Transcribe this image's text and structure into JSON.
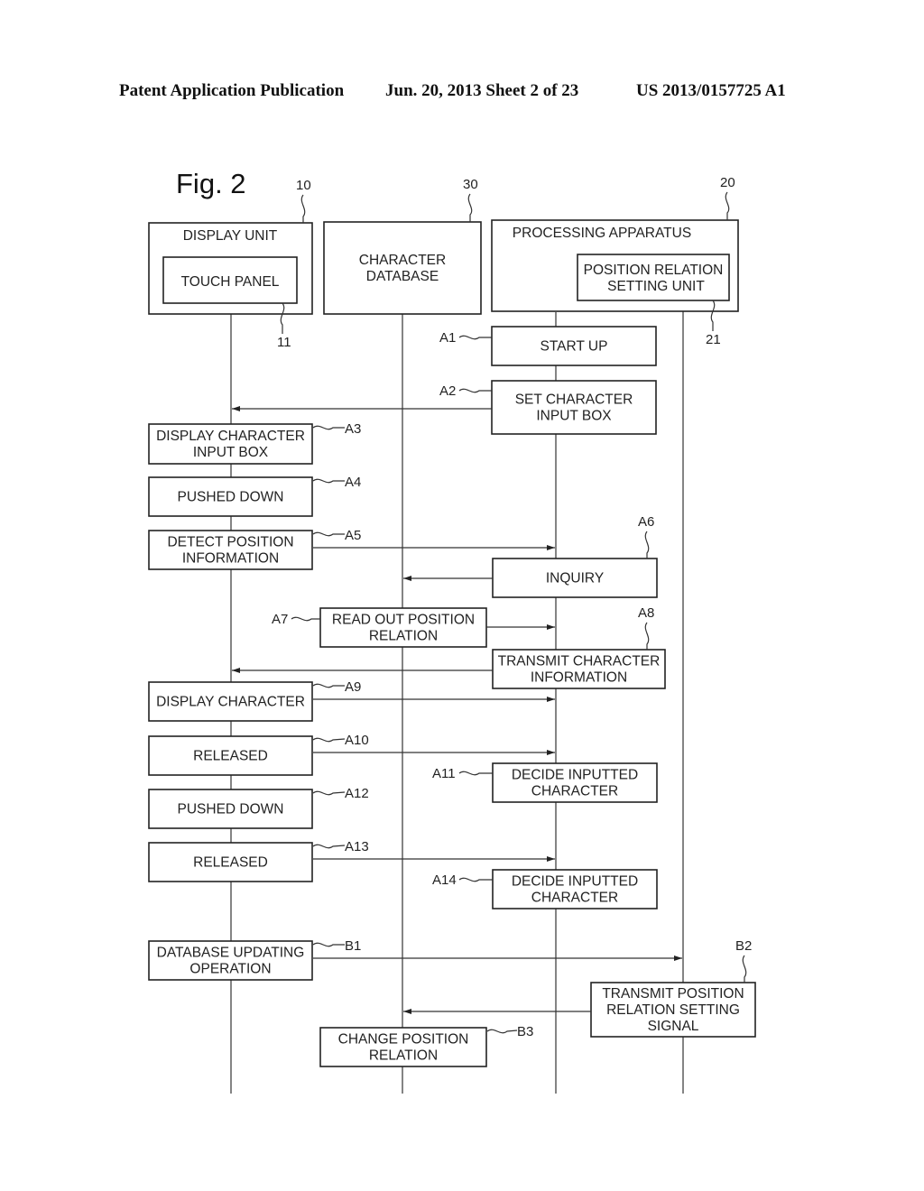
{
  "header": {
    "left": "Patent Application Publication",
    "middle": "Jun. 20, 2013  Sheet 2 of 23",
    "right": "US 2013/0157725 A1"
  },
  "figure": {
    "title": "Fig. 2",
    "lifelines": {
      "display_unit": {
        "ref": "10",
        "label": "DISPLAY UNIT",
        "sub": {
          "ref": "11",
          "label": "TOUCH PANEL"
        }
      },
      "character_database": {
        "ref": "30",
        "lines": [
          "CHARACTER",
          "DATABASE"
        ]
      },
      "processing_apparatus": {
        "ref": "20",
        "label": "PROCESSING APPARATUS",
        "sub": {
          "ref": "21",
          "lines": [
            "POSITION RELATION",
            "SETTING UNIT"
          ]
        }
      }
    },
    "steps": [
      {
        "id": "A1",
        "lines": [
          "START UP"
        ]
      },
      {
        "id": "A2",
        "lines": [
          "SET CHARACTER",
          "INPUT BOX"
        ]
      },
      {
        "id": "A3",
        "lines": [
          "DISPLAY CHARACTER",
          "INPUT BOX"
        ]
      },
      {
        "id": "A4",
        "lines": [
          "PUSHED DOWN"
        ]
      },
      {
        "id": "A5",
        "lines": [
          "DETECT POSITION",
          "INFORMATION"
        ]
      },
      {
        "id": "A6",
        "lines": [
          "INQUIRY"
        ]
      },
      {
        "id": "A7",
        "lines": [
          "READ OUT POSITION",
          "RELATION"
        ]
      },
      {
        "id": "A8",
        "lines": [
          "TRANSMIT CHARACTER",
          "INFORMATION"
        ]
      },
      {
        "id": "A9",
        "lines": [
          "DISPLAY CHARACTER"
        ]
      },
      {
        "id": "A10",
        "lines": [
          "RELEASED"
        ]
      },
      {
        "id": "A11",
        "lines": [
          "DECIDE INPUTTED",
          "CHARACTER"
        ]
      },
      {
        "id": "A12",
        "lines": [
          "PUSHED DOWN"
        ]
      },
      {
        "id": "A13",
        "lines": [
          "RELEASED"
        ]
      },
      {
        "id": "A14",
        "lines": [
          "DECIDE INPUTTED",
          "CHARACTER"
        ]
      },
      {
        "id": "B1",
        "lines": [
          "DATABASE UPDATING",
          "OPERATION"
        ]
      },
      {
        "id": "B2",
        "lines": [
          "TRANSMIT POSITION",
          "RELATION SETTING",
          "SIGNAL"
        ]
      },
      {
        "id": "B3",
        "lines": [
          "CHANGE POSITION",
          "RELATION"
        ]
      }
    ]
  }
}
